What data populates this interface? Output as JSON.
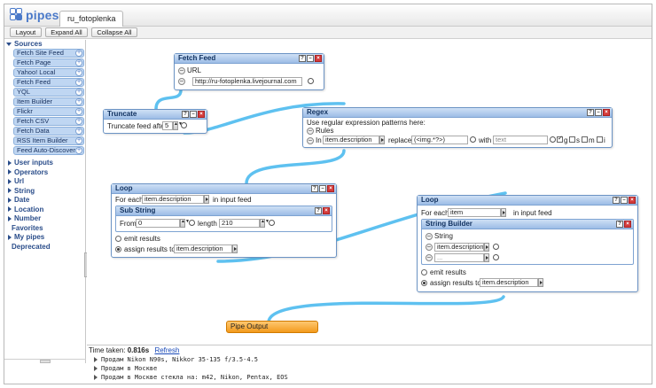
{
  "app": {
    "logo_text": "pipes",
    "tab_title": "ru_fotoplenka"
  },
  "toolbar": {
    "layout": "Layout",
    "expand_all": "Expand All",
    "collapse_all": "Collapse All"
  },
  "sidebar": {
    "sources_heading": "Sources",
    "sources": [
      "Fetch Site Feed",
      "Fetch Page",
      "Yahoo! Local",
      "Fetch Feed",
      "YQL",
      "Item Builder",
      "Flickr",
      "Fetch CSV",
      "Fetch Data",
      "RSS Item Builder",
      "Feed Auto-Discover"
    ],
    "categories": [
      "User inputs",
      "Operators",
      "Url",
      "String",
      "Date",
      "Location",
      "Number"
    ],
    "extra": [
      "Favorites",
      "My pipes",
      "Deprecated"
    ]
  },
  "modules": {
    "fetch_feed": {
      "title": "Fetch Feed",
      "url_label": "URL",
      "url_value": "http://ru-fotoplenka.livejournal.com"
    },
    "truncate": {
      "title": "Truncate",
      "label": "Truncate feed after",
      "value": "5"
    },
    "regex": {
      "title": "Regex",
      "description": "Use regular expression patterns here:",
      "rules_label": "Rules",
      "in_label": "In",
      "in_value": "item.description",
      "replace_label": "replace",
      "replace_value": "(<img.*?>)",
      "with_label": "with",
      "with_placeholder": "text",
      "flag_g": "g",
      "flag_s": "s",
      "flag_m": "m",
      "flag_i": "i"
    },
    "loop1": {
      "title": "Loop",
      "for_each_label": "For each",
      "for_each_value": "item.description",
      "in_feed_label": "in input feed",
      "inner_title": "Sub String",
      "from_label": "From",
      "from_value": "0",
      "length_label": "length",
      "length_value": "210",
      "emit_label": "emit results",
      "assign_label": "assign results to",
      "assign_value": "item.description"
    },
    "loop2": {
      "title": "Loop",
      "for_each_label": "For each",
      "for_each_value": "item",
      "in_feed_label": "in input feed",
      "inner_title": "String Builder",
      "string_label": "String",
      "string_value": "item.description",
      "string_placeholder": "...",
      "emit_label": "emit results",
      "assign_label": "assign results to",
      "assign_value": "item.description"
    },
    "pipe_output": {
      "title": "Pipe Output"
    }
  },
  "debugger": {
    "time_label": "Time taken:",
    "time_value": "0.816s",
    "refresh": "Refresh",
    "lines": [
      "Продам Nikon N90s, Nikkor 35-135 f/3.5-4.5",
      "Продам в Москве",
      "Продам в Москве стекла на: m42, Nikon, Pentax, EOS"
    ]
  },
  "colors": {
    "wire": "#5ec1f0",
    "module_header": "#9cbce6",
    "output": "#f39a1c",
    "link": "#1a4ab8"
  }
}
